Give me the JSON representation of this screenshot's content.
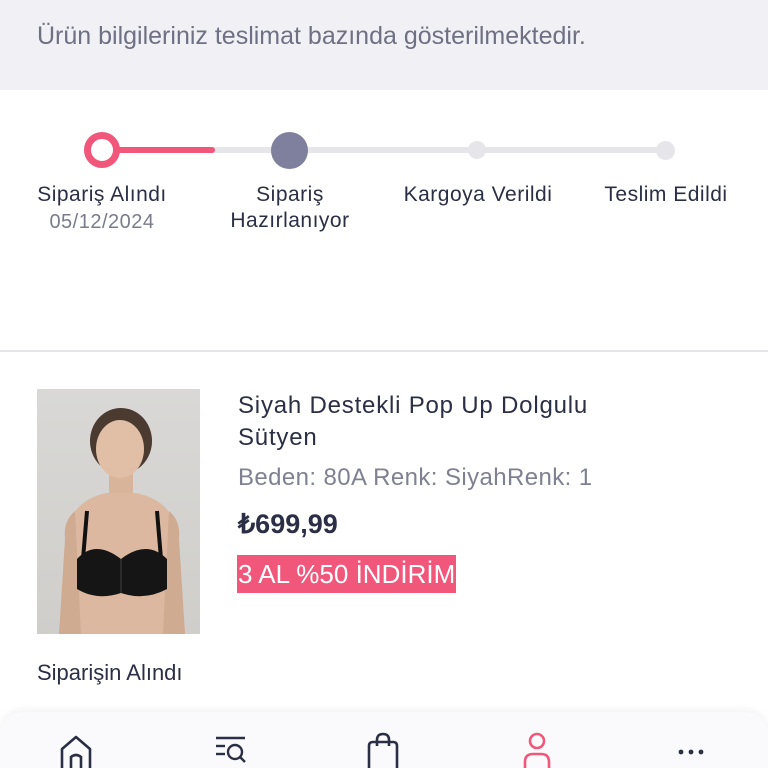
{
  "info": {
    "text": "Ürün bilgileriniz teslimat bazında gösterilmektedir."
  },
  "progress": {
    "steps": [
      {
        "label": "Sipariş Alındı",
        "date": "05/12/2024"
      },
      {
        "label": "Sipariş Hazırlanıyor"
      },
      {
        "label": "Kargoya Verildi"
      },
      {
        "label": "Teslim Edildi"
      }
    ]
  },
  "product": {
    "name": "Siyah Destekli Pop Up Dolgulu Sütyen",
    "attributes": "Beden: 80A Renk: SiyahRenk: 1",
    "price": "₺699,99",
    "promo": "3 AL %50 İNDİRİM",
    "status": "Siparişin Alındı"
  },
  "nav": {
    "items": [
      {
        "icon": "home-icon"
      },
      {
        "icon": "search-list-icon"
      },
      {
        "icon": "shopping-bag-icon"
      },
      {
        "icon": "account-icon",
        "active": true
      },
      {
        "icon": "more-icon"
      }
    ]
  },
  "colors": {
    "accent": "#f0577b",
    "current_step": "#7f809d",
    "text": "#2b2f45",
    "muted": "#7f8192",
    "banner_bg": "#f1f1f5"
  }
}
